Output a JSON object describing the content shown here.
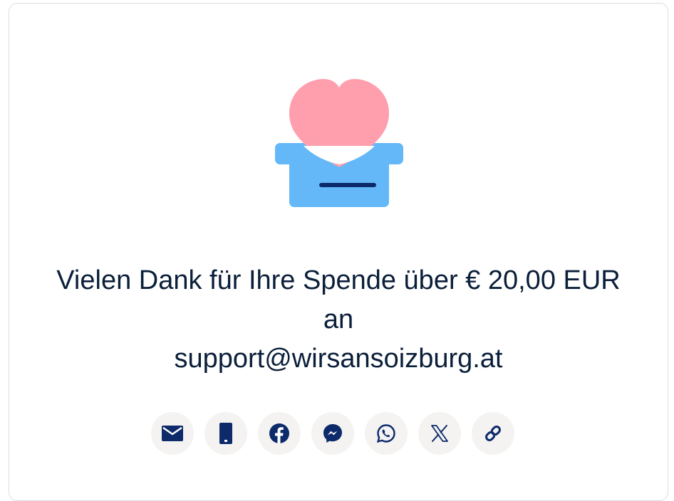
{
  "confirmation": {
    "line1": "Vielen Dank für Ihre Spende über € 20,00 EUR",
    "line2": "an",
    "line3": "support@wirsansoizburg.at"
  },
  "share": {
    "buttons": [
      {
        "id": "email",
        "icon": "envelope-icon"
      },
      {
        "id": "sms",
        "icon": "mobile-phone-icon"
      },
      {
        "id": "facebook",
        "icon": "facebook-icon"
      },
      {
        "id": "messenger",
        "icon": "messenger-icon"
      },
      {
        "id": "whatsapp",
        "icon": "whatsapp-icon"
      },
      {
        "id": "x",
        "icon": "x-logo-icon"
      },
      {
        "id": "copy-link",
        "icon": "link-icon"
      }
    ]
  },
  "colors": {
    "heart": "#ff9fae",
    "box": "#64b8f7",
    "slot": "#0d2a6b",
    "icon": "#0d2a6b",
    "text": "#0b1f3a",
    "button_bg": "#f4f3f1"
  }
}
